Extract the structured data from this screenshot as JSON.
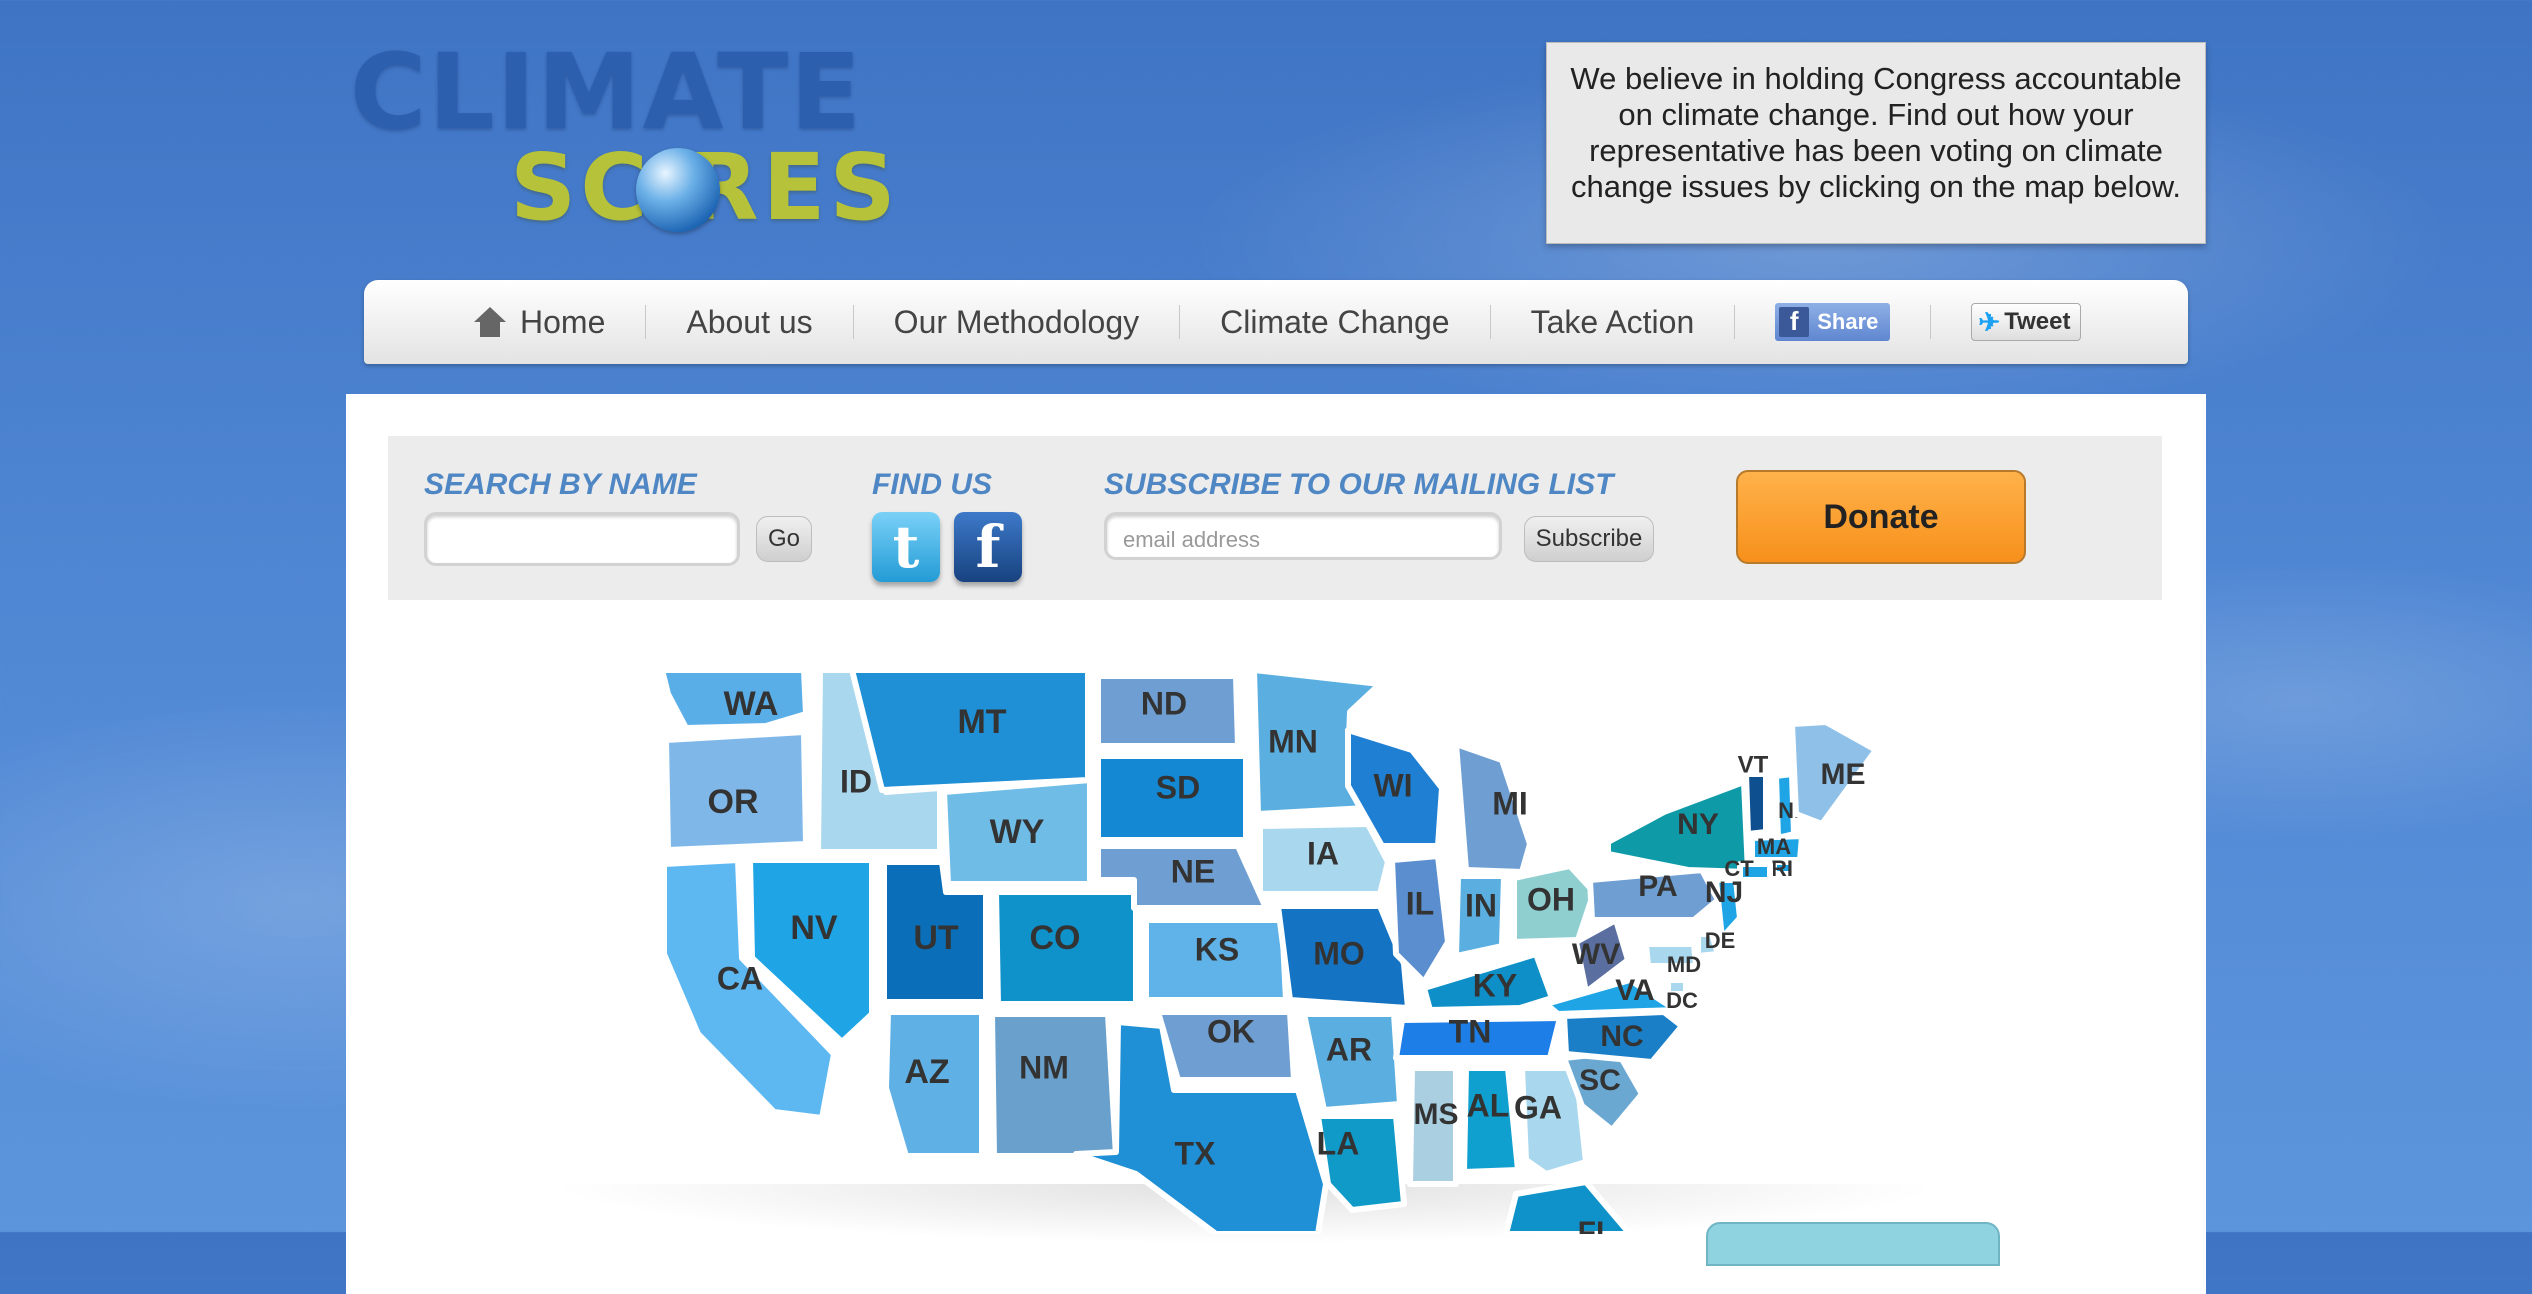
{
  "header": {
    "logo_line1": "CLIMATE",
    "logo_line2": "SC  RES",
    "intro_text": "We believe in holding Congress accountable on climate change. Find out how your representative has been voting on climate change issues by clicking on the map below."
  },
  "nav": {
    "items": [
      {
        "label": "Home",
        "icon": "home-icon"
      },
      {
        "label": "About us"
      },
      {
        "label": "Our Methodology"
      },
      {
        "label": "Climate Change"
      },
      {
        "label": "Take Action"
      }
    ],
    "share_label": "Share",
    "share_icon_text": "f",
    "tweet_label": "Tweet",
    "tweet_icon_text": "✈"
  },
  "toolbar": {
    "search_heading": "SEARCH BY NAME",
    "go_label": "Go",
    "find_heading": "FIND US",
    "twitter_icon_text": "t",
    "facebook_icon_text": "f",
    "subscribe_heading": "SUBSCRIBE TO OUR MAILING LIST",
    "email_placeholder": "email address",
    "subscribe_label": "Subscribe",
    "donate_label": "Donate"
  },
  "map": {
    "states": [
      {
        "abbr": "WA",
        "color": "#5aaee8"
      },
      {
        "abbr": "OR",
        "color": "#7fb8e8"
      },
      {
        "abbr": "ID",
        "color": "#a9d8ee"
      },
      {
        "abbr": "MT",
        "color": "#1f8fd6"
      },
      {
        "abbr": "WY",
        "color": "#6fbde6"
      },
      {
        "abbr": "CA",
        "color": "#5db8f2"
      },
      {
        "abbr": "NV",
        "color": "#1fa5e6"
      },
      {
        "abbr": "UT",
        "color": "#0a6fb8"
      },
      {
        "abbr": "CO",
        "color": "#0f91c9"
      },
      {
        "abbr": "AZ",
        "color": "#5fb0e4"
      },
      {
        "abbr": "NM",
        "color": "#6aa0cc"
      },
      {
        "abbr": "ND",
        "color": "#6f9fd2"
      },
      {
        "abbr": "SD",
        "color": "#1488d2"
      },
      {
        "abbr": "NE",
        "color": "#6f9fd2"
      },
      {
        "abbr": "KS",
        "color": "#5fb3e8"
      },
      {
        "abbr": "OK",
        "color": "#6f9fd2"
      },
      {
        "abbr": "TX",
        "color": "#1f8fd6"
      },
      {
        "abbr": "MN",
        "color": "#5aaee0"
      },
      {
        "abbr": "IA",
        "color": "#a9d8ee"
      },
      {
        "abbr": "MO",
        "color": "#1473c2"
      },
      {
        "abbr": "AR",
        "color": "#5aaee0"
      },
      {
        "abbr": "LA",
        "color": "#0f9ac8"
      },
      {
        "abbr": "WI",
        "color": "#1f7fd2"
      },
      {
        "abbr": "IL",
        "color": "#5a8ecf"
      },
      {
        "abbr": "MS",
        "color": "#a9cfe0"
      },
      {
        "abbr": "MI",
        "color": "#6f9fd2"
      },
      {
        "abbr": "IN",
        "color": "#5aaee0"
      },
      {
        "abbr": "OH",
        "color": "#8fcfd0"
      },
      {
        "abbr": "KY",
        "color": "#0f8fc8"
      },
      {
        "abbr": "TN",
        "color": "#1c7ee6"
      },
      {
        "abbr": "AL",
        "color": "#0fa0cf"
      },
      {
        "abbr": "GA",
        "color": "#a9d8ee"
      },
      {
        "abbr": "FL",
        "color": "#0f91c9"
      },
      {
        "abbr": "SC",
        "color": "#6aa8d2"
      },
      {
        "abbr": "NC",
        "color": "#1a7fc6"
      },
      {
        "abbr": "VA",
        "color": "#1fa5e6"
      },
      {
        "abbr": "WV",
        "color": "#5a6fa0"
      },
      {
        "abbr": "PA",
        "color": "#6f9fd2"
      },
      {
        "abbr": "NY",
        "color": "#0f9aa8"
      },
      {
        "abbr": "VT",
        "color": "#0d4f8f"
      },
      {
        "abbr": "NH",
        "color": "#1fa5e6"
      },
      {
        "abbr": "ME",
        "color": "#8fc0e8"
      },
      {
        "abbr": "MA",
        "color": "#1fa5e6"
      },
      {
        "abbr": "RI",
        "color": "#1fa5e6"
      },
      {
        "abbr": "CT",
        "color": "#1fa5e6"
      },
      {
        "abbr": "NJ",
        "color": "#1fa5e6"
      },
      {
        "abbr": "DE",
        "color": "#a9d8ee"
      },
      {
        "abbr": "MD",
        "color": "#a9d8ee"
      },
      {
        "abbr": "DC",
        "color": "#a9d8ee"
      }
    ]
  }
}
